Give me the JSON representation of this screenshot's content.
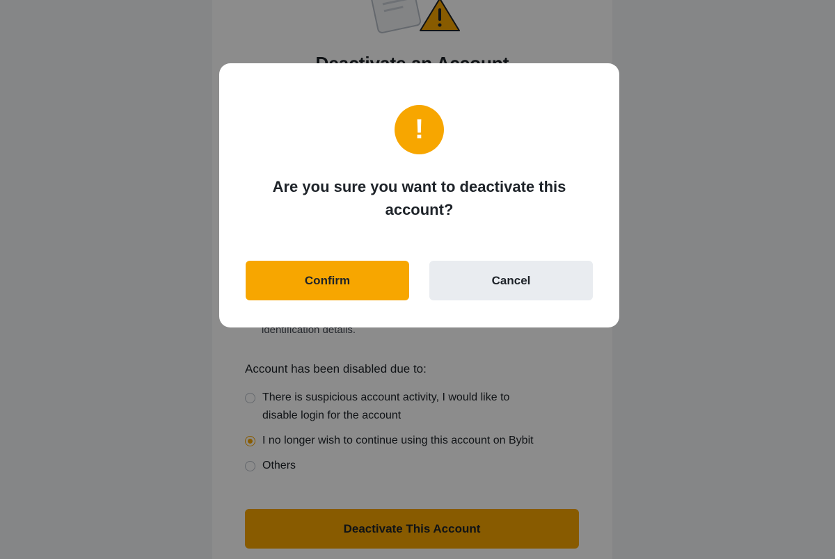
{
  "page": {
    "title_partial": "Deactivate an Account",
    "fragment_text": "identification details.",
    "reasons_heading": "Account has been disabled due to:",
    "reasons": [
      {
        "label_line1": "There is suspicious account activity, I would like to",
        "label_line2": "disable login for the account",
        "selected": false
      },
      {
        "label": "I no longer wish to continue using this account on Bybit",
        "selected": true
      },
      {
        "label": "Others",
        "selected": false
      }
    ],
    "deactivate_label": "Deactivate This Account"
  },
  "dialog": {
    "icon": "warning-exclamation-icon",
    "icon_glyph": "!",
    "title_line1": "Are you sure you want to deactivate this",
    "title_line2": "account?",
    "confirm_label": "Confirm",
    "cancel_label": "Cancel"
  },
  "colors": {
    "accent": "#f7a600",
    "cancel_bg": "#e9ecf0",
    "text": "#1e2329"
  }
}
